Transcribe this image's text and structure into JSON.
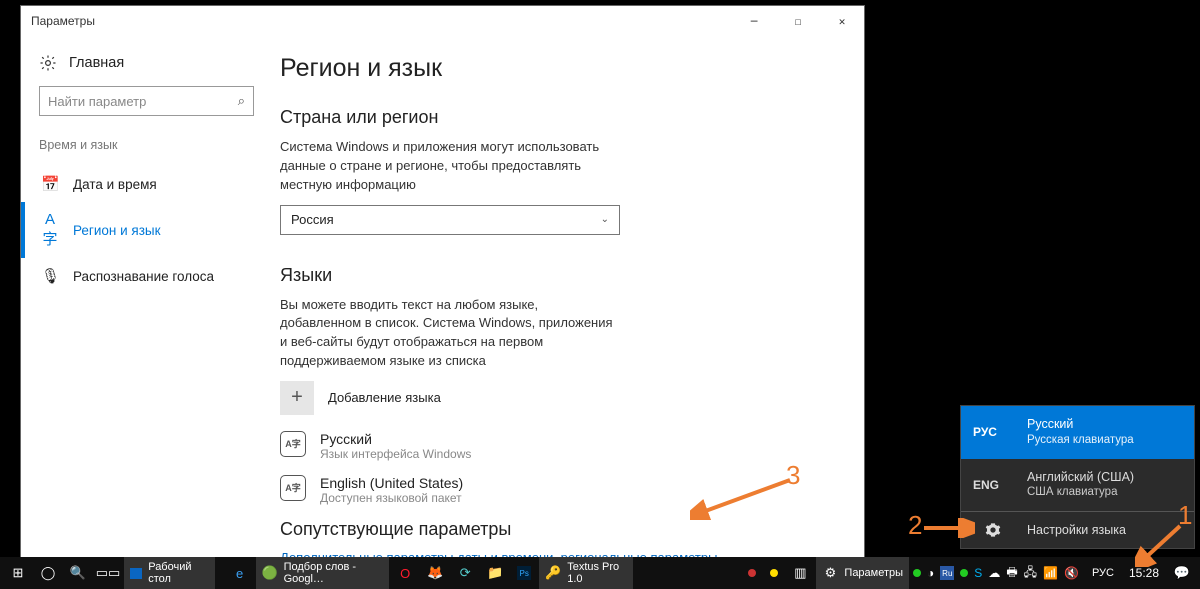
{
  "window": {
    "title": "Параметры",
    "home": "Главная",
    "search_placeholder": "Найти параметр",
    "group_label": "Время и язык",
    "nav": [
      {
        "icon": "🕘",
        "label": "Дата и время"
      },
      {
        "icon": "✱",
        "label": "Регион и язык"
      },
      {
        "icon": "🎤",
        "label": "Распознавание голоса"
      }
    ]
  },
  "main": {
    "heading": "Регион и язык",
    "country_heading": "Страна или регион",
    "country_desc": "Система Windows и приложения могут использовать данные о стране и регионе, чтобы предоставлять местную информацию",
    "country_value": "Россия",
    "lang_heading": "Языки",
    "lang_desc": "Вы можете вводить текст на любом языке, добавленном в список. Система Windows, приложения и веб-сайты будут отображаться на первом поддерживаемом языке из списка",
    "add_lang": "Добавление языка",
    "langs": [
      {
        "title": "Русский",
        "sub": "Язык интерфейса Windows"
      },
      {
        "title": "English (United States)",
        "sub": "Доступен языковой пакет"
      }
    ],
    "related_heading": "Сопутствующие параметры",
    "related_link": "Дополнительные параметры даты и времени, региональные параметры"
  },
  "flyout": {
    "items": [
      {
        "code": "РУС",
        "name": "Русский",
        "sub": "Русская клавиатура",
        "selected": true
      },
      {
        "code": "ENG",
        "name": "Английский (США)",
        "sub": "США клавиатура",
        "selected": false
      }
    ],
    "settings": "Настройки языка"
  },
  "taskbar": {
    "desktop_label": "Рабочий стол",
    "tasks": [
      {
        "label": "Подбор слов - Googl…"
      },
      {
        "label": ""
      },
      {
        "label": "Textus Pro 1.0"
      },
      {
        "label": "Параметры"
      }
    ],
    "lang": "РУС",
    "time": "15:28"
  },
  "annotations": {
    "n1": "1",
    "n2": "2",
    "n3": "3"
  }
}
